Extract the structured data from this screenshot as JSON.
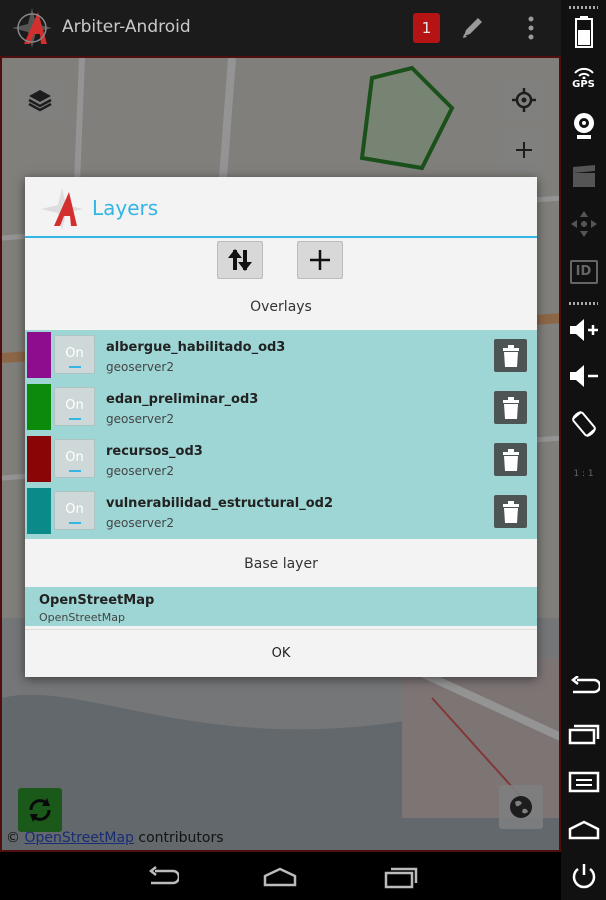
{
  "app": {
    "title": "Arbiter-Android",
    "notification_count": "1"
  },
  "map": {
    "attribution_prefix": "©",
    "attribution_link": "OpenStreetMap",
    "attribution_suffix": " contributors"
  },
  "dialog": {
    "title": "Layers",
    "overlays_label": "Overlays",
    "base_label": "Base layer",
    "ok_label": "OK",
    "overlays": [
      {
        "name": "albergue_habilitado_od3",
        "source": "geoserver2",
        "toggle": "On",
        "color": "#8e0c8e"
      },
      {
        "name": "edan_preliminar_od3",
        "source": "geoserver2",
        "toggle": "On",
        "color": "#0b8a0b"
      },
      {
        "name": "recursos_od3",
        "source": "geoserver2",
        "toggle": "On",
        "color": "#8a0606"
      },
      {
        "name": "vulnerabilidad_estructural_od2",
        "source": "geoserver2",
        "toggle": "On",
        "color": "#0b8a8a"
      }
    ],
    "base_layer": {
      "name": "OpenStreetMap",
      "source": "OpenStreetMap"
    }
  },
  "sidebar": {
    "gps_label": "GPS",
    "id_label": "ID",
    "ratio_label": "1 : 1"
  },
  "colors": {
    "accent": "#33b5e5",
    "list_bg": "#9dd6d4",
    "badge": "#b51414"
  }
}
